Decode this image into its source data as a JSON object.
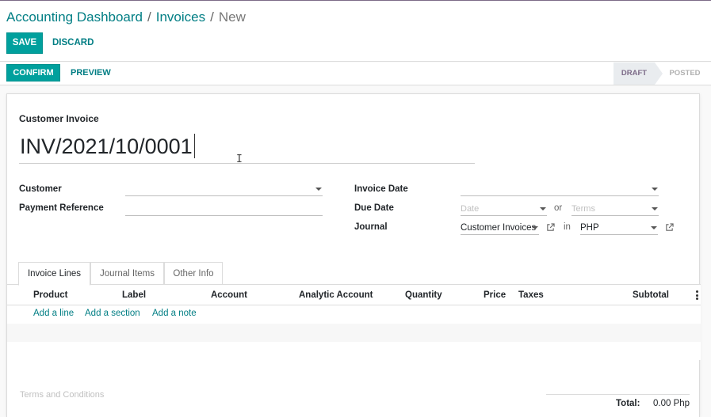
{
  "breadcrumb": {
    "root": "Accounting Dashboard",
    "parent": "Invoices",
    "current": "New",
    "separator": "/"
  },
  "toolbar": {
    "save_label": "SAVE",
    "discard_label": "DISCARD"
  },
  "statusbar": {
    "confirm_label": "CONFIRM",
    "preview_label": "PREVIEW",
    "stages": [
      "DRAFT",
      "POSTED"
    ],
    "active_stage": "DRAFT"
  },
  "form": {
    "type_label": "Customer Invoice",
    "number": "INV/2021/10/0001",
    "customer_label": "Customer",
    "customer_value": "",
    "payment_ref_label": "Payment Reference",
    "payment_ref_value": "",
    "invoice_date_label": "Invoice Date",
    "invoice_date_value": "",
    "due_date_label": "Due Date",
    "due_date_placeholder": "Date",
    "or_word": "or",
    "terms_placeholder": "Terms",
    "journal_label": "Journal",
    "journal_value": "Customer Invoices",
    "in_word": "in",
    "currency_value": "PHP"
  },
  "tabs": [
    {
      "label": "Invoice Lines",
      "active": true
    },
    {
      "label": "Journal Items",
      "active": false
    },
    {
      "label": "Other Info",
      "active": false
    }
  ],
  "lines_table": {
    "columns": [
      "Product",
      "Label",
      "Account",
      "Analytic Account",
      "Quantity",
      "Price",
      "Taxes",
      "Subtotal"
    ],
    "actions": [
      "Add a line",
      "Add a section",
      "Add a note"
    ]
  },
  "footer": {
    "terms_placeholder": "Terms and Conditions",
    "total_label": "Total:",
    "total_value": "0.00 Php"
  },
  "colors": {
    "primary": "#00a09d",
    "link": "#017e84",
    "draft_stage": "#7c6a87"
  }
}
